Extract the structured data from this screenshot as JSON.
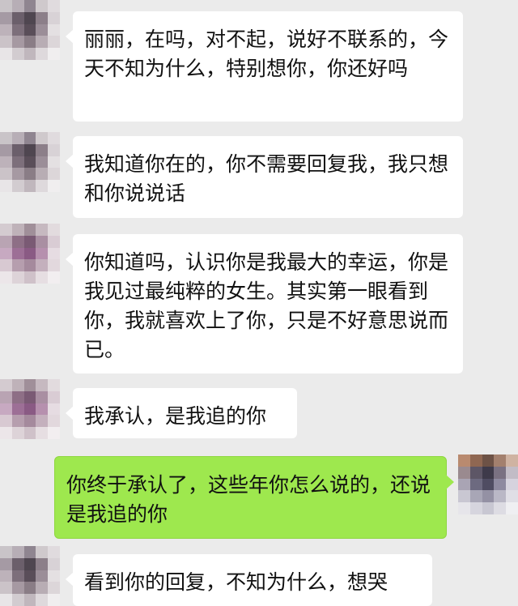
{
  "chat": {
    "messages": [
      {
        "sender": "contact",
        "text": "丽丽，在吗，对不起，说好不联系的，今天不知为什么，特别想你，你还好吗"
      },
      {
        "sender": "contact",
        "text": "我知道你在的，你不需要回复我，我只想和你说说话"
      },
      {
        "sender": "contact",
        "text": "你知道吗，认识你是我最大的幸运，你是我见过最纯粹的女生。其实第一眼看到你，我就喜欢上了你，只是不好意思说而已。"
      },
      {
        "sender": "contact",
        "text": "我承认，是我追的你"
      },
      {
        "sender": "self",
        "text": "你终于承认了，这些年你怎么说的，还说是我追的你"
      },
      {
        "sender": "contact",
        "text": "看到你的回复，不知为什么，想哭"
      }
    ]
  },
  "colors": {
    "background": "#ebebeb",
    "incoming_bubble": "#ffffff",
    "outgoing_bubble": "#9ee84e"
  },
  "icons": {
    "contact_avatar": "pixelated-avatar-icon",
    "self_avatar": "pixelated-avatar-icon"
  }
}
